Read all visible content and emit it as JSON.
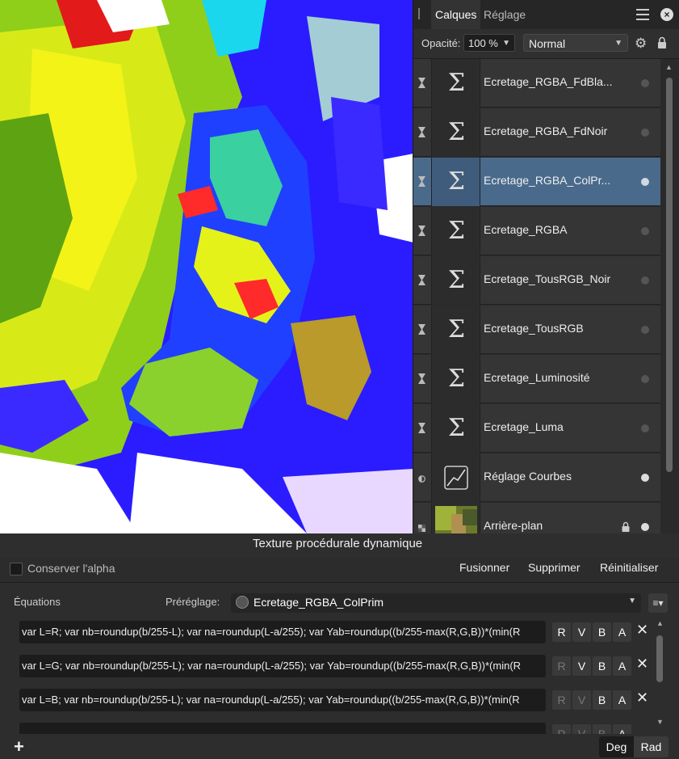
{
  "panel": {
    "tabs": [
      {
        "label": "Calques"
      },
      {
        "label": "Réglage"
      }
    ],
    "opacity_label": "Opacité:",
    "opacity_value": "100 %",
    "blend_mode": "Normal",
    "layers": [
      {
        "name": "Ecretage_RGBA_FdBla...",
        "type": "procedural",
        "visible": false
      },
      {
        "name": "Ecretage_RGBA_FdNoir",
        "type": "procedural",
        "visible": false
      },
      {
        "name": "Ecretage_RGBA_ColPr...",
        "type": "procedural",
        "visible": true,
        "selected": true
      },
      {
        "name": "Ecretage_RGBA",
        "type": "procedural",
        "visible": false
      },
      {
        "name": "Ecretage_TousRGB_Noir",
        "type": "procedural",
        "visible": false
      },
      {
        "name": "Ecretage_TousRGB",
        "type": "procedural",
        "visible": false
      },
      {
        "name": "Ecretage_Luminosité",
        "type": "procedural",
        "visible": false
      },
      {
        "name": "Ecretage_Luma",
        "type": "procedural",
        "visible": false
      },
      {
        "name": "Réglage Courbes",
        "type": "curves",
        "visible": true
      },
      {
        "name": "Arrière-plan",
        "type": "pixel",
        "visible": true,
        "locked": true
      }
    ],
    "bottom_icons": [
      "layers-icon",
      "mask-icon",
      "adjustment-icon",
      "fx-icon",
      "hourglass-icon",
      "folder-icon",
      "checker-icon",
      "trash-icon"
    ]
  },
  "context": {
    "title": "Texture procédurale dynamique",
    "preserve_alpha": "Conserver l'alpha",
    "merge": "Fusionner",
    "delete": "Supprimer",
    "reset": "Réinitialiser"
  },
  "equations": {
    "label": "Équations",
    "preset_label": "Préréglage:",
    "preset_value": "Ecretage_RGBA_ColPrim",
    "rows": [
      {
        "text": "var L=R; var nb=roundup(b/255-L); var na=roundup(L-a/255); var Yab=roundup((b/255-max(R,G,B))*(min(R",
        "channels": [
          {
            "label": "R",
            "on": true
          },
          {
            "label": "V",
            "on": true
          },
          {
            "label": "B",
            "on": true
          },
          {
            "label": "A",
            "on": true
          }
        ]
      },
      {
        "text": "var L=G; var nb=roundup(b/255-L); var na=roundup(L-a/255); var Yab=roundup((b/255-max(R,G,B))*(min(R",
        "channels": [
          {
            "label": "R",
            "on": false
          },
          {
            "label": "V",
            "on": true
          },
          {
            "label": "B",
            "on": true
          },
          {
            "label": "A",
            "on": true
          }
        ]
      },
      {
        "text": "var L=B; var nb=roundup(b/255-L); var na=roundup(L-a/255); var Yab=roundup((b/255-max(R,G,B))*(min(R",
        "channels": [
          {
            "label": "R",
            "on": false
          },
          {
            "label": "V",
            "on": false
          },
          {
            "label": "B",
            "on": true
          },
          {
            "label": "A",
            "on": true
          }
        ]
      },
      {
        "text": "",
        "channels": [
          {
            "label": "R",
            "on": false
          },
          {
            "label": "V",
            "on": false
          },
          {
            "label": "B",
            "on": false
          },
          {
            "label": "A",
            "on": true
          }
        ]
      }
    ],
    "deg": "Deg",
    "rad": "Rad"
  },
  "colors": {
    "selection": "#4a6a8c",
    "panel": "#2a2a2a",
    "canvas_blue": "#2b1cff"
  }
}
